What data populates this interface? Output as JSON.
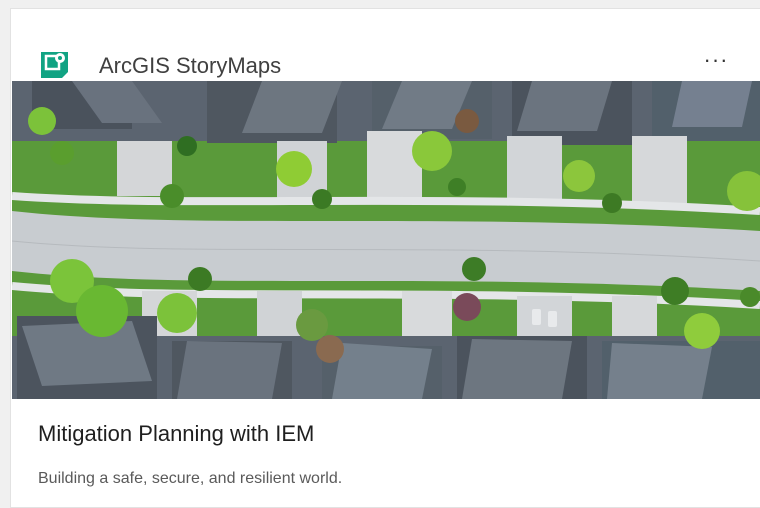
{
  "card": {
    "app_name": "ArcGIS StoryMaps",
    "app_icon": "storymaps-logo-icon",
    "menu_icon": "more-options-icon",
    "menu_label": "···",
    "hero_image": "aerial-suburban-neighborhood-image",
    "title": "Mitigation Planning with IEM",
    "description": "Building a safe, secure, and resilient world."
  },
  "colors": {
    "brand": "#11a383",
    "title_text": "#1f1f1f",
    "body_text": "#5a5a5a",
    "background": "#ffffff"
  }
}
